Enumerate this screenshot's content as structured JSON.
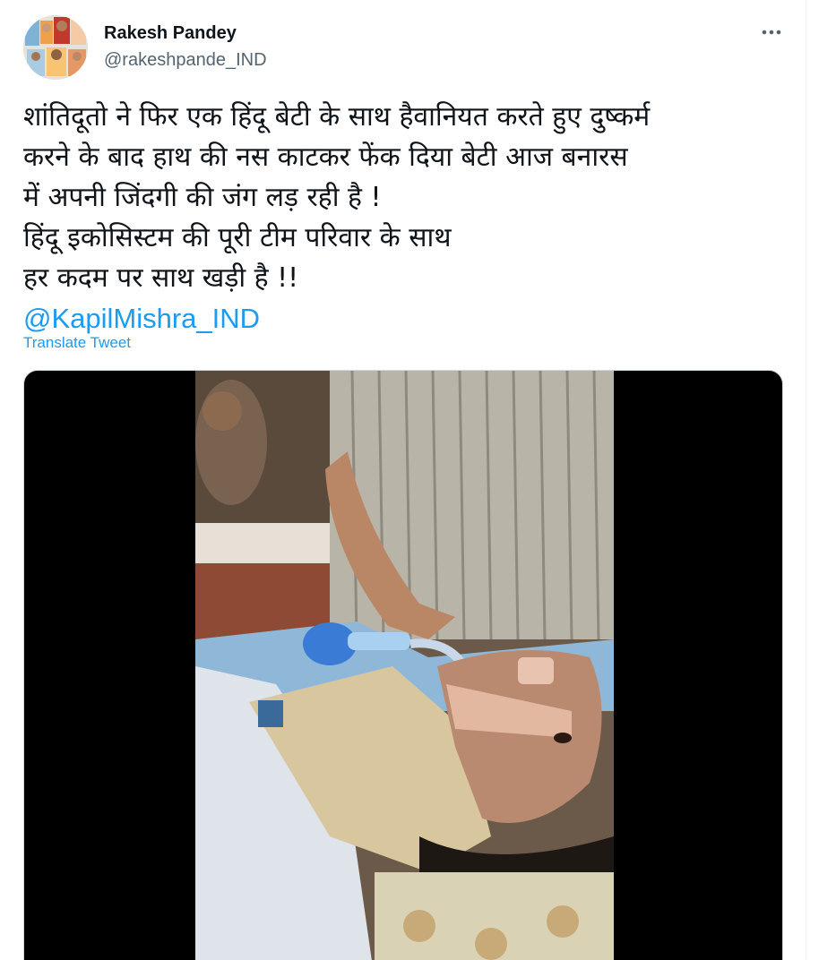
{
  "user": {
    "display_name": "Rakesh Pandey",
    "handle": "@rakeshpande_IND"
  },
  "tweet": {
    "lines": [
      "शांतिदूतो ने फिर एक हिंदू बेटी के साथ हैवानियत करते हुए दुष्कर्म",
      "करने के बाद हाथ की नस काटकर फेंक दिया बेटी आज बनारस",
      "में अपनी जिंदगी की जंग लड़ रही है !",
      "हिंदू इकोसिस्टम की पूरी टीम परिवार के साथ",
      "हर कदम पर साथ खड़ी है  !!"
    ],
    "mention": "@KapilMishra_IND",
    "translate_label": "Translate Tweet"
  },
  "icons": {
    "more": "more-options-icon"
  },
  "colors": {
    "link": "#1d9bf0",
    "text": "#0f1419",
    "secondary": "#536471"
  }
}
